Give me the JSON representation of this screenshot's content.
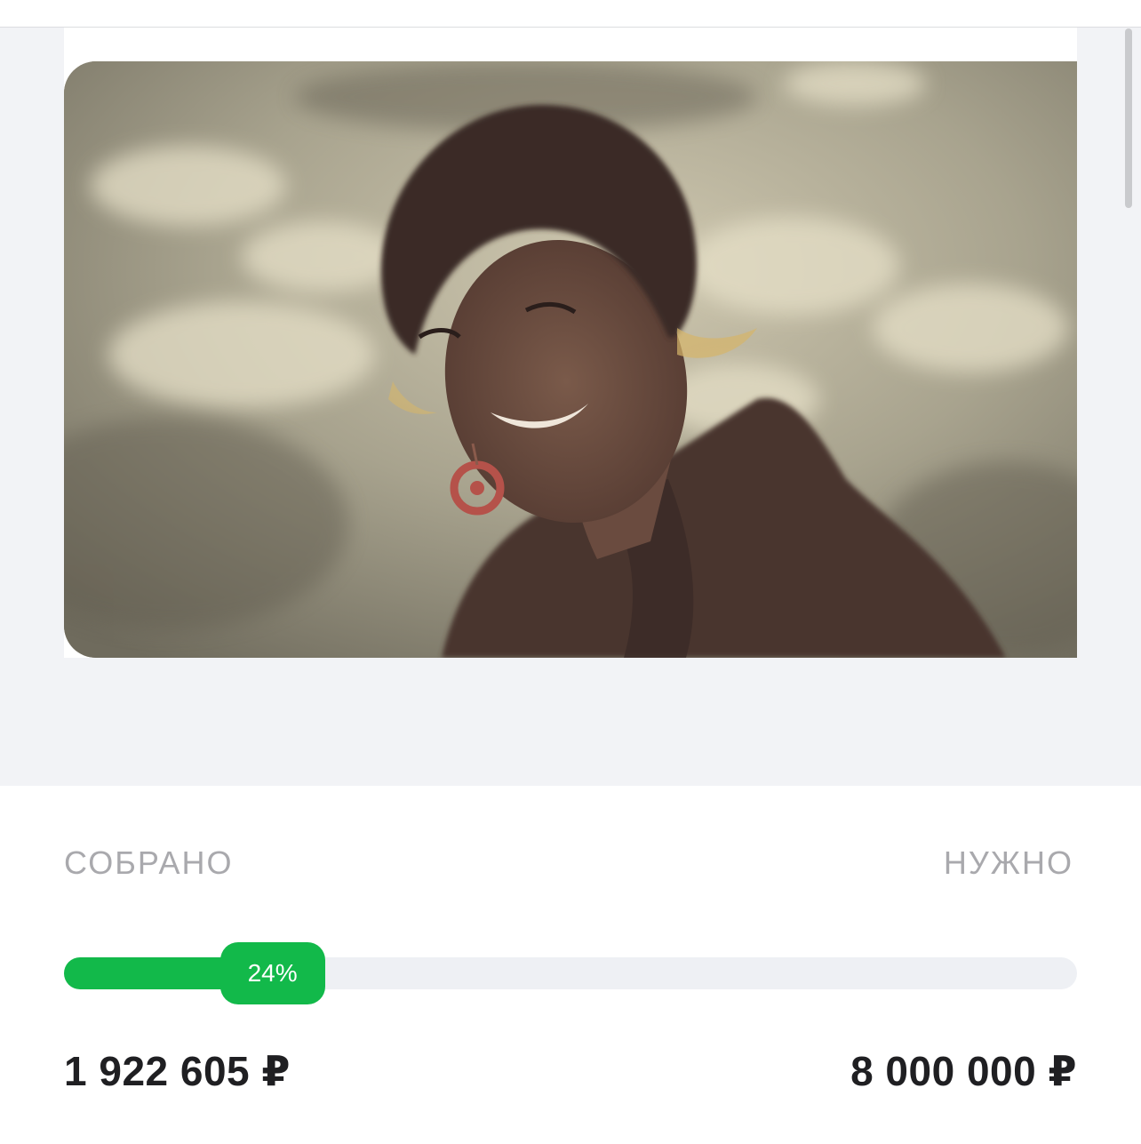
{
  "campaign": {
    "collected_label": "СОБРАНО",
    "needed_label": "НУЖНО",
    "progress_fraction": 0.24,
    "progress_text": "24%",
    "collected_amount": "1 922 605 ₽",
    "needed_amount": "8 000 000 ₽"
  },
  "colors": {
    "accent_green": "#12b94a",
    "label_gray": "#a9a9ad",
    "background_gray": "#f2f3f6"
  }
}
